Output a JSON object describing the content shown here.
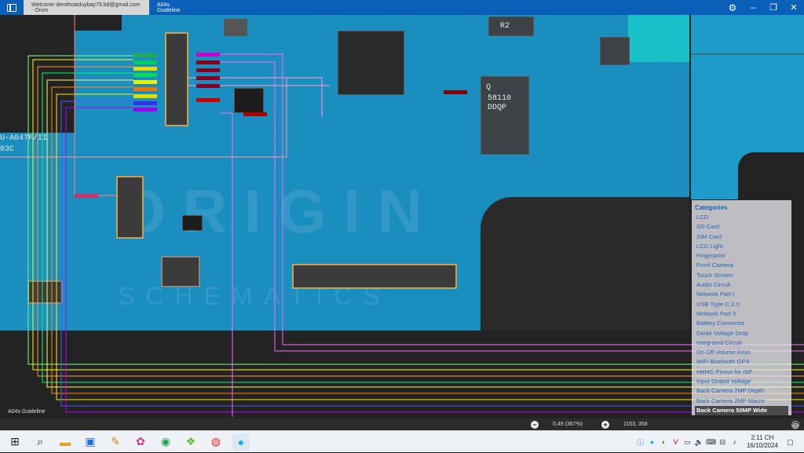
{
  "titlebar": {
    "tabs": [
      {
        "label": "Welcome dienthoaiduybay79.bd@gmail.com - Orion",
        "active": false
      },
      {
        "label": "A04s Guideline",
        "active": true
      }
    ],
    "icons": [
      "app-layout-icon",
      "gear-icon",
      "minimize-icon",
      "restore-icon",
      "close-icon"
    ]
  },
  "board": {
    "model_text": "U-A047F/II",
    "model_text2": "03C",
    "watermark_main": "ORIGIN",
    "watermark_sub": "SCHEMATICS",
    "chip_label1": "Q",
    "chip_label2": "58110",
    "chip_label3": "DDQP",
    "chip_label4": "R2",
    "footer_label": "A04s Guideline"
  },
  "categories": {
    "title": "Categories",
    "items": [
      "LCD",
      "SD Card",
      "SIM Card",
      "LCD Light",
      "Fingerprint",
      "Front Camera",
      "Touch Screen",
      "Audio Circuit",
      "Network Part I",
      "USB Type-C 2.0",
      "Network Part II",
      "Battery Connector",
      "Diode Voltage Drop",
      "Integrated Circuit",
      "On Off Volume Keys",
      "WiFi Bluetooth GPS",
      "eMMC Pinout for ISP",
      "Input Output Voltage",
      "Back Camera 2MP Depth",
      "Back Camera 2MP Macro",
      "Back Camera 50MP Wide"
    ],
    "selected": "Back Camera 50MP Wide"
  },
  "statusbar": {
    "zoom": "0,49 (367%)",
    "coords": "1153, 358"
  },
  "taskbar": {
    "apps": [
      "windows-start-icon",
      "search-icon",
      "file-explorer-icon",
      "store-icon",
      "paint-icon",
      "photos-icon",
      "tripadvisor-icon",
      "app-icon",
      "chrome-icon",
      "orion-icon"
    ],
    "time": "2:11 CH",
    "date": "16/10/2024"
  },
  "colors": {
    "titlebar": "#0a5fb8",
    "board": "#1b8ec0",
    "category_text": "#2a63b8",
    "selected_bg": "#4a4a4a"
  }
}
